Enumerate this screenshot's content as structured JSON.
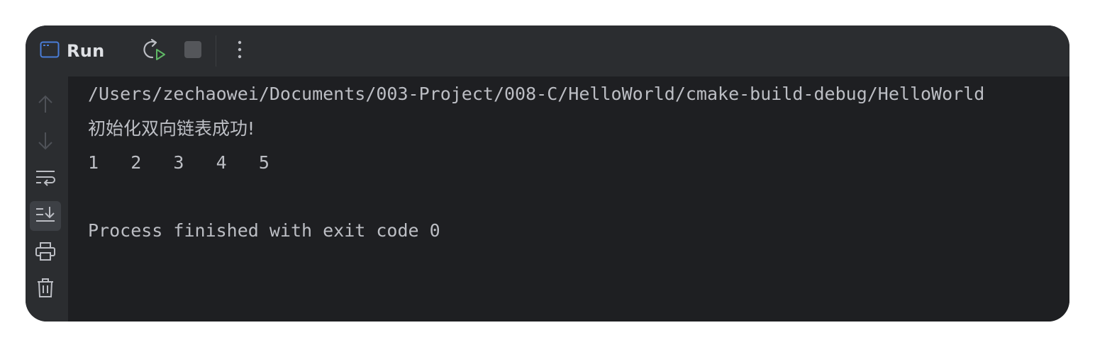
{
  "toolbar": {
    "title": "Run",
    "icons": [
      "console-window-icon",
      "rerun-icon",
      "stop-icon",
      "more-vertical-icon"
    ]
  },
  "gutter": {
    "icons": [
      "arrow-up-icon",
      "arrow-down-icon",
      "soft-wrap-icon",
      "scroll-to-end-icon",
      "print-icon",
      "trash-icon"
    ],
    "active": "scroll-to-end-icon"
  },
  "console": {
    "lines": [
      "/Users/zechaowei/Documents/003-Project/008-C/HelloWorld/cmake-build-debug/HelloWorld",
      "初始化双向链表成功!",
      "1   2   3   4   5",
      "",
      "Process finished with exit code 0"
    ]
  },
  "colors": {
    "window_bg": "#1e1f22",
    "toolbar_bg": "#2b2d30",
    "text": "#bcbec4",
    "title": "#dfe1e5",
    "icon": "#8b8e94",
    "rerun_accent": "#5fb865",
    "console_icon_accent": "#4a7dd8"
  }
}
